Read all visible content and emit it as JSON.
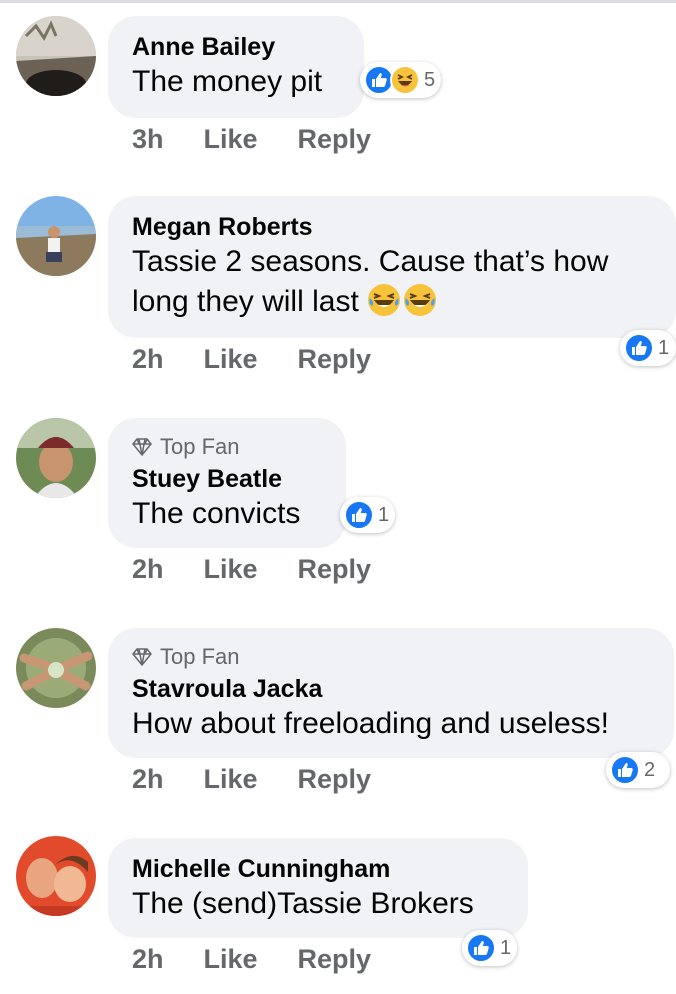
{
  "comments": [
    {
      "author": "Anne Bailey",
      "badge": "",
      "text": "The money pit",
      "time": "3h",
      "like_label": "Like",
      "reply_label": "Reply",
      "reactions": [
        "like",
        "haha"
      ],
      "reaction_count": "5"
    },
    {
      "author": "Megan Roberts",
      "badge": "",
      "text": "Tassie 2 seasons. Cause that’s how long they will last",
      "time": "2h",
      "like_label": "Like",
      "reply_label": "Reply",
      "reactions": [
        "like"
      ],
      "reaction_count": "1"
    },
    {
      "author": "Stuey Beatle",
      "badge": "Top Fan",
      "text": "The convicts",
      "time": "2h",
      "like_label": "Like",
      "reply_label": "Reply",
      "reactions": [
        "like"
      ],
      "reaction_count": "1"
    },
    {
      "author": "Stavroula Jacka",
      "badge": "Top Fan",
      "text": "How about freeloading and useless!",
      "time": "2h",
      "like_label": "Like",
      "reply_label": "Reply",
      "reactions": [
        "like"
      ],
      "reaction_count": "2"
    },
    {
      "author": "Michelle Cunningham",
      "badge": "",
      "text": "The (send)Tassie Brokers",
      "time": "2h",
      "like_label": "Like",
      "reply_label": "Reply",
      "reactions": [
        "like"
      ],
      "reaction_count": "1"
    }
  ],
  "colors": {
    "like_blue": "#1877f2",
    "bubble": "#f0f2f5",
    "meta": "#65676b"
  }
}
